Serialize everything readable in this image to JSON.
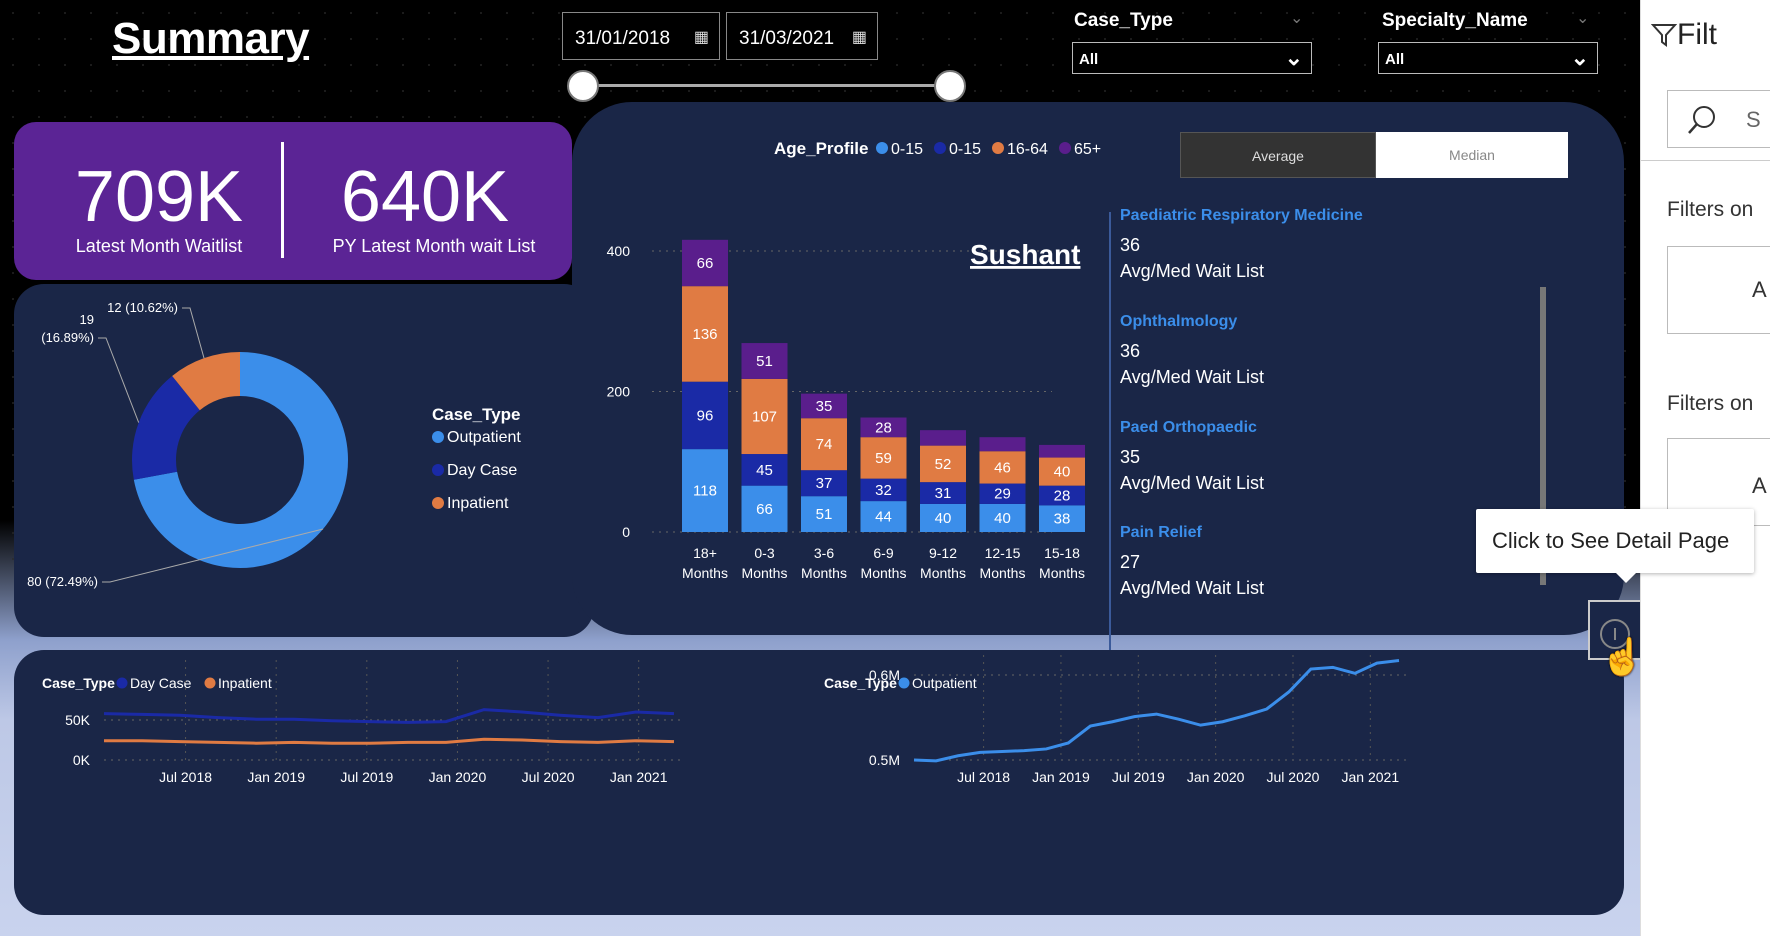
{
  "header": {
    "title": "Summary"
  },
  "dates": {
    "start": "31/01/2018",
    "end": "31/03/2021"
  },
  "filters": {
    "case_type": {
      "label": "Case_Type",
      "value": "All"
    },
    "specialty": {
      "label": "Specialty_Name",
      "value": "All"
    }
  },
  "kpi": [
    {
      "value": "709K",
      "label": "Latest Month Waitlist"
    },
    {
      "value": "640K",
      "label": "PY Latest Month wait List"
    }
  ],
  "toggle": {
    "average": "Average",
    "median": "Median",
    "selected": "Median"
  },
  "watermark": "Sushant",
  "specialties": [
    {
      "name": "Paediatric Respiratory Medicine",
      "value": "36",
      "label": "Avg/Med Wait List"
    },
    {
      "name": "Ophthalmology",
      "value": "36",
      "label": "Avg/Med Wait List"
    },
    {
      "name": "Paed Orthopaedic",
      "value": "35",
      "label": "Avg/Med Wait List"
    },
    {
      "name": "Pain Relief",
      "value": "27",
      "label": "Avg/Med Wait List"
    }
  ],
  "tooltip": "Click to See Detail Page",
  "filter_pane": {
    "title": "Filt",
    "search": "S",
    "filters_on_1": "Filters on",
    "filters_on_2": "Filters on",
    "box1": "A",
    "box2": "A"
  },
  "colors": {
    "outpatient": "#3b8eea",
    "day_case": "#1a2aa6",
    "inpatient": "#e07b43",
    "age_65": "#5a1e8c",
    "panel": "#1a2647",
    "kpi": "#5b2495"
  },
  "chart_data": [
    {
      "type": "pie",
      "legend_title": "Case_Type",
      "categories": [
        "Outpatient",
        "Day Case",
        "Inpatient"
      ],
      "values": [
        80,
        19,
        12
      ],
      "labels": [
        "80 (72.49%)",
        "19 (16.89%)",
        "12 (10.62%)"
      ],
      "colors": [
        "#3b8eea",
        "#1a2aa6",
        "#e07b43"
      ]
    },
    {
      "type": "bar",
      "stacked": true,
      "legend_title": "Age_Profile",
      "categories": [
        "18+ Months",
        "0-3 Months",
        "3-6 Months",
        "6-9 Months",
        "9-12 Months",
        "12-15 Months",
        "15-18 Months"
      ],
      "series": [
        {
          "name": "0-15",
          "color": "#3b8eea",
          "values": [
            118,
            66,
            51,
            44,
            40,
            40,
            38
          ]
        },
        {
          "name": "0-15",
          "color": "#1a2aa6",
          "values": [
            96,
            45,
            37,
            32,
            31,
            29,
            28
          ]
        },
        {
          "name": "16-64",
          "color": "#e07b43",
          "values": [
            136,
            107,
            74,
            59,
            52,
            46,
            40
          ]
        },
        {
          "name": "65+",
          "color": "#5a1e8c",
          "values": [
            66,
            51,
            35,
            28,
            22,
            20,
            18
          ]
        }
      ],
      "value_labels": [
        [
          "118",
          "66",
          "51",
          "44",
          "40",
          "40",
          "38"
        ],
        [
          "96",
          "45",
          "37",
          "32",
          "31",
          "29",
          "28"
        ],
        [
          "136",
          "107",
          "74",
          "59",
          "52",
          "46",
          "40"
        ],
        [
          "66",
          "51",
          "35",
          "28",
          "",
          "",
          ""
        ]
      ],
      "yticks": [
        "0",
        "200",
        "400"
      ],
      "ylim": [
        0,
        420
      ]
    },
    {
      "type": "line",
      "legend_title": "Case_Type",
      "x_ticks": [
        "Jul 2018",
        "Jan 2019",
        "Jul 2019",
        "Jan 2020",
        "Jul 2020",
        "Jan 2021"
      ],
      "yticks": [
        "0K",
        "50K"
      ],
      "ylim": [
        0,
        100000
      ],
      "series": [
        {
          "name": "Day Case",
          "color": "#1a2aa6",
          "values": [
            58000,
            57000,
            56000,
            53000,
            51000,
            51000,
            49000,
            48000,
            47000,
            48000,
            63000,
            60000,
            56000,
            53000,
            60000,
            58000
          ]
        },
        {
          "name": "Inpatient",
          "color": "#e07b43",
          "values": [
            24000,
            24000,
            23000,
            22000,
            21000,
            22000,
            21000,
            21000,
            22000,
            22000,
            26000,
            25000,
            23000,
            22000,
            24000,
            23000
          ]
        }
      ]
    },
    {
      "type": "line",
      "legend_title": "Case_Type",
      "x_ticks": [
        "Jul 2018",
        "Jan 2019",
        "Jul 2019",
        "Jan 2020",
        "Jul 2020",
        "Jan 2021"
      ],
      "yticks": [
        "0.5M",
        "0.6M"
      ],
      "ylim": [
        0.5,
        0.6
      ],
      "series": [
        {
          "name": "Outpatient",
          "color": "#3b8eea",
          "values": [
            0.5,
            0.499,
            0.505,
            0.509,
            0.51,
            0.511,
            0.513,
            0.52,
            0.54,
            0.545,
            0.551,
            0.554,
            0.548,
            0.541,
            0.545,
            0.552,
            0.56,
            0.58,
            0.607,
            0.609,
            0.602,
            0.614,
            0.617
          ]
        }
      ]
    }
  ]
}
